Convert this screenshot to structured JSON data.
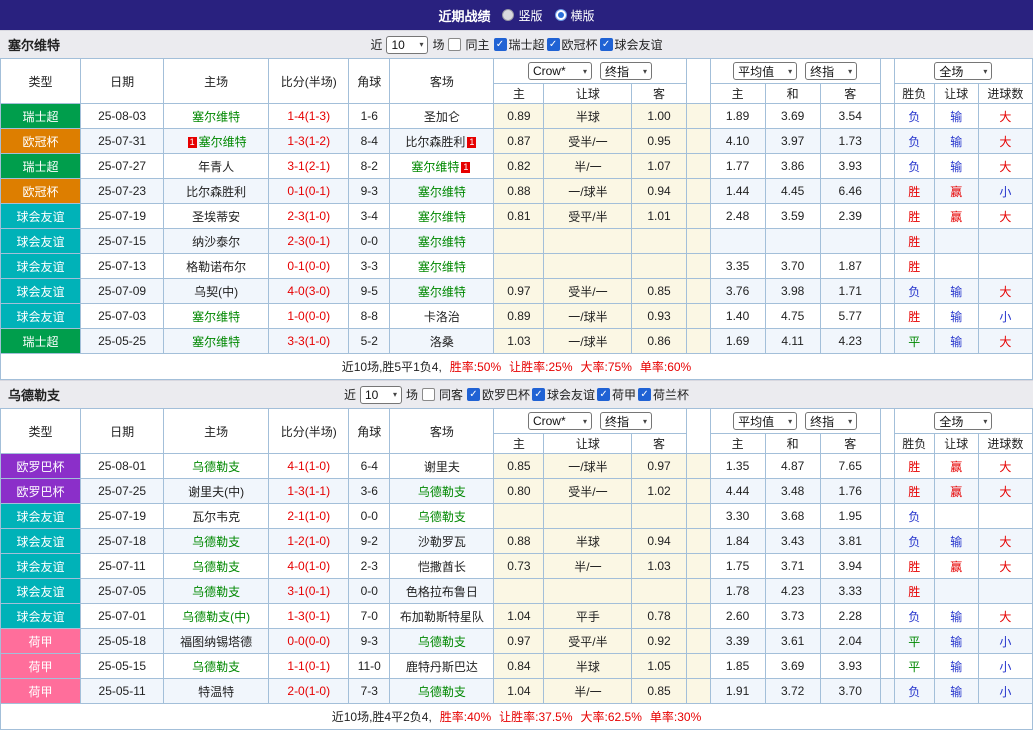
{
  "icons": {
    "dropdown_arrow": "▾",
    "check": "✓"
  },
  "colors": {
    "league": {
      "瑞士超": "#009e4c",
      "欧冠杯": "#dd7e00",
      "球会友谊": "#00b2b8",
      "欧罗巴杯": "#8b2fc9",
      "荷甲": "#ff6e9b"
    },
    "values": {
      "胜": "#e60000",
      "平": "#008800",
      "负": "#2433cc",
      "赢": "#e60000",
      "输": "#2433cc",
      "大": "#e60000",
      "小": "#2433cc"
    },
    "tracked_team": "#008800",
    "score": "#e60000",
    "summary_stat": "#e60000"
  },
  "title_bar": {
    "title": "近期战绩",
    "options": [
      {
        "label": "竖版",
        "selected": false
      },
      {
        "label": "横版",
        "selected": true
      }
    ]
  },
  "table_headers": {
    "type": "类型",
    "date": "日期",
    "home": "主场",
    "score": "比分(半场)",
    "corners": "角球",
    "away": "客场",
    "odds_group": {
      "company": "Crow*",
      "stage": "终指",
      "cols": [
        "主",
        "让球",
        "客"
      ]
    },
    "avg_group": {
      "company": "平均值",
      "stage": "终指",
      "cols": [
        "主",
        "和",
        "客"
      ]
    },
    "full_group": {
      "scope": "全场",
      "cols": [
        "胜负",
        "让球",
        "进球数"
      ]
    }
  },
  "sections": [
    {
      "team": "塞尔维特",
      "filter": {
        "near": "近",
        "count": "10",
        "unit": "场",
        "same": {
          "label": "同主",
          "checked": false
        },
        "leagues": [
          {
            "label": "瑞士超",
            "checked": true
          },
          {
            "label": "欧冠杯",
            "checked": true
          },
          {
            "label": "球会友谊",
            "checked": true
          }
        ]
      },
      "rows": [
        {
          "league": "瑞士超",
          "date": "25-08-03",
          "home": {
            "name": "塞尔维特",
            "tracked": true
          },
          "score": "1-4(1-3)",
          "corners": "1-6",
          "away": {
            "name": "圣加仑"
          },
          "odds": [
            "0.89",
            "半球",
            "1.00"
          ],
          "avg": [
            "1.89",
            "3.69",
            "3.54"
          ],
          "result": [
            "负",
            "输",
            "大"
          ]
        },
        {
          "league": "欧冠杯",
          "date": "25-07-31",
          "home": {
            "name": "塞尔维特",
            "tracked": true,
            "rc_pre": "1"
          },
          "score": "1-3(1-2)",
          "corners": "8-4",
          "away": {
            "name": "比尔森胜利",
            "rc_post": "1"
          },
          "odds": [
            "0.87",
            "受半/一",
            "0.95"
          ],
          "avg": [
            "4.10",
            "3.97",
            "1.73"
          ],
          "result": [
            "负",
            "输",
            "大"
          ]
        },
        {
          "league": "瑞士超",
          "date": "25-07-27",
          "home": {
            "name": "年青人"
          },
          "score": "3-1(2-1)",
          "corners": "8-2",
          "away": {
            "name": "塞尔维特",
            "tracked": true,
            "rc_post": "1"
          },
          "odds": [
            "0.82",
            "半/一",
            "1.07"
          ],
          "avg": [
            "1.77",
            "3.86",
            "3.93"
          ],
          "result": [
            "负",
            "输",
            "大"
          ]
        },
        {
          "league": "欧冠杯",
          "date": "25-07-23",
          "home": {
            "name": "比尔森胜利"
          },
          "score": "0-1(0-1)",
          "corners": "9-3",
          "away": {
            "name": "塞尔维特",
            "tracked": true
          },
          "odds": [
            "0.88",
            "一/球半",
            "0.94"
          ],
          "avg": [
            "1.44",
            "4.45",
            "6.46"
          ],
          "result": [
            "胜",
            "赢",
            "小"
          ]
        },
        {
          "league": "球会友谊",
          "date": "25-07-19",
          "home": {
            "name": "圣埃蒂安"
          },
          "score": "2-3(1-0)",
          "corners": "3-4",
          "away": {
            "name": "塞尔维特",
            "tracked": true
          },
          "odds": [
            "0.81",
            "受平/半",
            "1.01"
          ],
          "avg": [
            "2.48",
            "3.59",
            "2.39"
          ],
          "result": [
            "胜",
            "赢",
            "大"
          ]
        },
        {
          "league": "球会友谊",
          "date": "25-07-15",
          "home": {
            "name": "纳沙泰尔"
          },
          "score": "2-3(0-1)",
          "corners": "0-0",
          "away": {
            "name": "塞尔维特",
            "tracked": true
          },
          "odds": [
            "",
            "",
            ""
          ],
          "avg": [
            "",
            "",
            ""
          ],
          "result": [
            "胜",
            "",
            ""
          ]
        },
        {
          "league": "球会友谊",
          "date": "25-07-13",
          "home": {
            "name": "格勒诺布尔"
          },
          "score": "0-1(0-0)",
          "corners": "3-3",
          "away": {
            "name": "塞尔维特",
            "tracked": true
          },
          "odds": [
            "",
            "",
            ""
          ],
          "avg": [
            "3.35",
            "3.70",
            "1.87"
          ],
          "result": [
            "胜",
            "",
            ""
          ]
        },
        {
          "league": "球会友谊",
          "date": "25-07-09",
          "home": {
            "name": "乌契(中)"
          },
          "score": "4-0(3-0)",
          "corners": "9-5",
          "away": {
            "name": "塞尔维特",
            "tracked": true
          },
          "odds": [
            "0.97",
            "受半/一",
            "0.85"
          ],
          "avg": [
            "3.76",
            "3.98",
            "1.71"
          ],
          "result": [
            "负",
            "输",
            "大"
          ]
        },
        {
          "league": "球会友谊",
          "date": "25-07-03",
          "home": {
            "name": "塞尔维特",
            "tracked": true
          },
          "score": "1-0(0-0)",
          "corners": "8-8",
          "away": {
            "name": "卡洛治"
          },
          "odds": [
            "0.89",
            "一/球半",
            "0.93"
          ],
          "avg": [
            "1.40",
            "4.75",
            "5.77"
          ],
          "result": [
            "胜",
            "输",
            "小"
          ]
        },
        {
          "league": "瑞士超",
          "date": "25-05-25",
          "home": {
            "name": "塞尔维特",
            "tracked": true
          },
          "score": "3-3(1-0)",
          "corners": "5-2",
          "away": {
            "name": "洛桑"
          },
          "odds": [
            "1.03",
            "一/球半",
            "0.86"
          ],
          "avg": [
            "1.69",
            "4.11",
            "4.23"
          ],
          "result": [
            "平",
            "输",
            "大"
          ]
        }
      ],
      "summary": {
        "prefix": "近10场,胜5平1负4,",
        "stats": [
          "胜率:50%",
          "让胜率:25%",
          "大率:75%",
          "单率:60%"
        ]
      }
    },
    {
      "team": "乌德勒支",
      "filter": {
        "near": "近",
        "count": "10",
        "unit": "场",
        "same": {
          "label": "同客",
          "checked": false
        },
        "leagues": [
          {
            "label": "欧罗巴杯",
            "checked": true
          },
          {
            "label": "球会友谊",
            "checked": true
          },
          {
            "label": "荷甲",
            "checked": true
          },
          {
            "label": "荷兰杯",
            "checked": true
          }
        ]
      },
      "rows": [
        {
          "league": "欧罗巴杯",
          "date": "25-08-01",
          "home": {
            "name": "乌德勒支",
            "tracked": true
          },
          "score": "4-1(1-0)",
          "corners": "6-4",
          "away": {
            "name": "谢里夫"
          },
          "odds": [
            "0.85",
            "一/球半",
            "0.97"
          ],
          "avg": [
            "1.35",
            "4.87",
            "7.65"
          ],
          "result": [
            "胜",
            "赢",
            "大"
          ]
        },
        {
          "league": "欧罗巴杯",
          "date": "25-07-25",
          "home": {
            "name": "谢里夫(中)"
          },
          "score": "1-3(1-1)",
          "corners": "3-6",
          "away": {
            "name": "乌德勒支",
            "tracked": true
          },
          "odds": [
            "0.80",
            "受半/一",
            "1.02"
          ],
          "avg": [
            "4.44",
            "3.48",
            "1.76"
          ],
          "result": [
            "胜",
            "赢",
            "大"
          ]
        },
        {
          "league": "球会友谊",
          "date": "25-07-19",
          "home": {
            "name": "瓦尔韦克"
          },
          "score": "2-1(1-0)",
          "corners": "0-0",
          "away": {
            "name": "乌德勒支",
            "tracked": true
          },
          "odds": [
            "",
            "",
            ""
          ],
          "avg": [
            "3.30",
            "3.68",
            "1.95"
          ],
          "result": [
            "负",
            "",
            ""
          ]
        },
        {
          "league": "球会友谊",
          "date": "25-07-18",
          "home": {
            "name": "乌德勒支",
            "tracked": true
          },
          "score": "1-2(1-0)",
          "corners": "9-2",
          "away": {
            "name": "沙勒罗瓦"
          },
          "odds": [
            "0.88",
            "半球",
            "0.94"
          ],
          "avg": [
            "1.84",
            "3.43",
            "3.81"
          ],
          "result": [
            "负",
            "输",
            "大"
          ]
        },
        {
          "league": "球会友谊",
          "date": "25-07-11",
          "home": {
            "name": "乌德勒支",
            "tracked": true
          },
          "score": "4-0(1-0)",
          "corners": "2-3",
          "away": {
            "name": "恺撒酋长"
          },
          "odds": [
            "0.73",
            "半/一",
            "1.03"
          ],
          "avg": [
            "1.75",
            "3.71",
            "3.94"
          ],
          "result": [
            "胜",
            "赢",
            "大"
          ]
        },
        {
          "league": "球会友谊",
          "date": "25-07-05",
          "home": {
            "name": "乌德勒支",
            "tracked": true
          },
          "score": "3-1(0-1)",
          "corners": "0-0",
          "away": {
            "name": "色格拉布鲁日"
          },
          "odds": [
            "",
            "",
            ""
          ],
          "avg": [
            "1.78",
            "4.23",
            "3.33"
          ],
          "result": [
            "胜",
            "",
            ""
          ]
        },
        {
          "league": "球会友谊",
          "date": "25-07-01",
          "home": {
            "name": "乌德勒支(中)",
            "tracked": true
          },
          "score": "1-3(0-1)",
          "corners": "7-0",
          "away": {
            "name": "布加勒斯特星队"
          },
          "odds": [
            "1.04",
            "平手",
            "0.78"
          ],
          "avg": [
            "2.60",
            "3.73",
            "2.28"
          ],
          "result": [
            "负",
            "输",
            "大"
          ]
        },
        {
          "league": "荷甲",
          "date": "25-05-18",
          "home": {
            "name": "福图纳锡塔德"
          },
          "score": "0-0(0-0)",
          "corners": "9-3",
          "away": {
            "name": "乌德勒支",
            "tracked": true
          },
          "odds": [
            "0.97",
            "受平/半",
            "0.92"
          ],
          "avg": [
            "3.39",
            "3.61",
            "2.04"
          ],
          "result": [
            "平",
            "输",
            "小"
          ]
        },
        {
          "league": "荷甲",
          "date": "25-05-15",
          "home": {
            "name": "乌德勒支",
            "tracked": true
          },
          "score": "1-1(0-1)",
          "corners": "11-0",
          "away": {
            "name": "鹿特丹斯巴达"
          },
          "odds": [
            "0.84",
            "半球",
            "1.05"
          ],
          "avg": [
            "1.85",
            "3.69",
            "3.93"
          ],
          "result": [
            "平",
            "输",
            "小"
          ]
        },
        {
          "league": "荷甲",
          "date": "25-05-11",
          "home": {
            "name": "特温特"
          },
          "score": "2-0(1-0)",
          "corners": "7-3",
          "away": {
            "name": "乌德勒支",
            "tracked": true
          },
          "odds": [
            "1.04",
            "半/一",
            "0.85"
          ],
          "avg": [
            "1.91",
            "3.72",
            "3.70"
          ],
          "result": [
            "负",
            "输",
            "小"
          ]
        }
      ],
      "summary": {
        "prefix": "近10场,胜4平2负4,",
        "stats": [
          "胜率:40%",
          "让胜率:37.5%",
          "大率:62.5%",
          "单率:30%"
        ]
      }
    }
  ]
}
